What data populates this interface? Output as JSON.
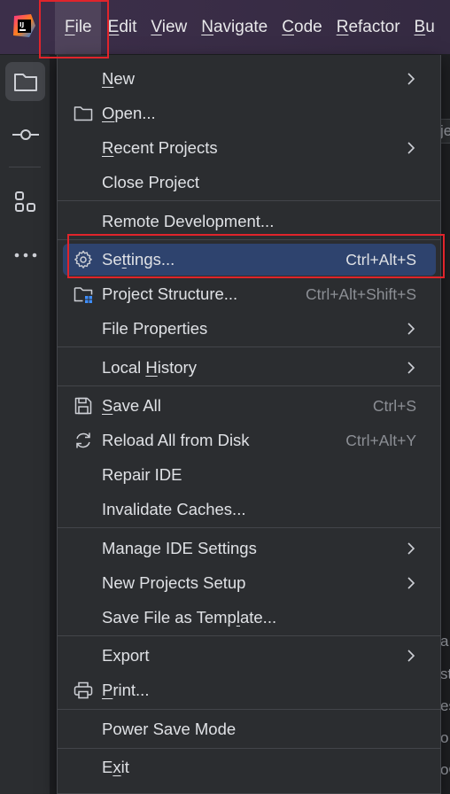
{
  "menubar": {
    "items": [
      "File",
      "Edit",
      "View",
      "Navigate",
      "Code",
      "Refactor",
      "Bu"
    ],
    "mnemonics": [
      "F",
      "E",
      "V",
      "N",
      "C",
      "R",
      "B"
    ]
  },
  "background_text": [
    "je",
    "a",
    "st",
    "es",
    "o",
    "oO"
  ],
  "file_menu": {
    "items": [
      {
        "pre": "",
        "mn": "N",
        "post": "ew",
        "shortcut": "",
        "submenu": true,
        "icon": ""
      },
      {
        "pre": "",
        "mn": "O",
        "post": "pen...",
        "shortcut": "",
        "submenu": false,
        "icon": "folder-icon"
      },
      {
        "pre": "",
        "mn": "R",
        "post": "ecent Projects",
        "shortcut": "",
        "submenu": true,
        "icon": ""
      },
      {
        "pre": "Close Project",
        "mn": "",
        "post": "",
        "shortcut": "",
        "submenu": false,
        "icon": ""
      },
      {
        "pre": "Remote Development...",
        "mn": "",
        "post": "",
        "shortcut": "",
        "submenu": false,
        "icon": ""
      },
      {
        "pre": "Se",
        "mn": "t",
        "post": "tings...",
        "shortcut": "Ctrl+Alt+S",
        "submenu": false,
        "icon": "gear-icon",
        "highlighted": true
      },
      {
        "pre": "Project Structure...",
        "mn": "",
        "post": "",
        "shortcut": "Ctrl+Alt+Shift+S",
        "submenu": false,
        "icon": "project-structure-icon"
      },
      {
        "pre": "File Properties",
        "mn": "",
        "post": "",
        "shortcut": "",
        "submenu": true,
        "icon": ""
      },
      {
        "pre": "Local ",
        "mn": "H",
        "post": "istory",
        "shortcut": "",
        "submenu": true,
        "icon": ""
      },
      {
        "pre": "",
        "mn": "S",
        "post": "ave All",
        "shortcut": "Ctrl+S",
        "submenu": false,
        "icon": "save-icon"
      },
      {
        "pre": "Reload All from Disk",
        "mn": "",
        "post": "",
        "shortcut": "Ctrl+Alt+Y",
        "submenu": false,
        "icon": "reload-icon"
      },
      {
        "pre": "Repair IDE",
        "mn": "",
        "post": "",
        "shortcut": "",
        "submenu": false,
        "icon": ""
      },
      {
        "pre": "Invalidate Caches...",
        "mn": "",
        "post": "",
        "shortcut": "",
        "submenu": false,
        "icon": ""
      },
      {
        "pre": "Manage IDE Settings",
        "mn": "",
        "post": "",
        "shortcut": "",
        "submenu": true,
        "icon": ""
      },
      {
        "pre": "New Projects Setup",
        "mn": "",
        "post": "",
        "shortcut": "",
        "submenu": true,
        "icon": ""
      },
      {
        "pre": "Save File as Temp",
        "mn": "l",
        "post": "ate...",
        "shortcut": "",
        "submenu": false,
        "icon": ""
      },
      {
        "pre": "Export",
        "mn": "",
        "post": "",
        "shortcut": "",
        "submenu": true,
        "icon": ""
      },
      {
        "pre": "",
        "mn": "P",
        "post": "rint...",
        "shortcut": "",
        "submenu": false,
        "icon": "print-icon"
      },
      {
        "pre": "Power Save Mode",
        "mn": "",
        "post": "",
        "shortcut": "",
        "submenu": false,
        "icon": ""
      },
      {
        "pre": "E",
        "mn": "x",
        "post": "it",
        "shortcut": "",
        "submenu": false,
        "icon": ""
      }
    ]
  },
  "colors": {
    "highlight": "#2e436e",
    "annotation_red": "#e0242b",
    "menu_bg": "#2b2d30"
  }
}
